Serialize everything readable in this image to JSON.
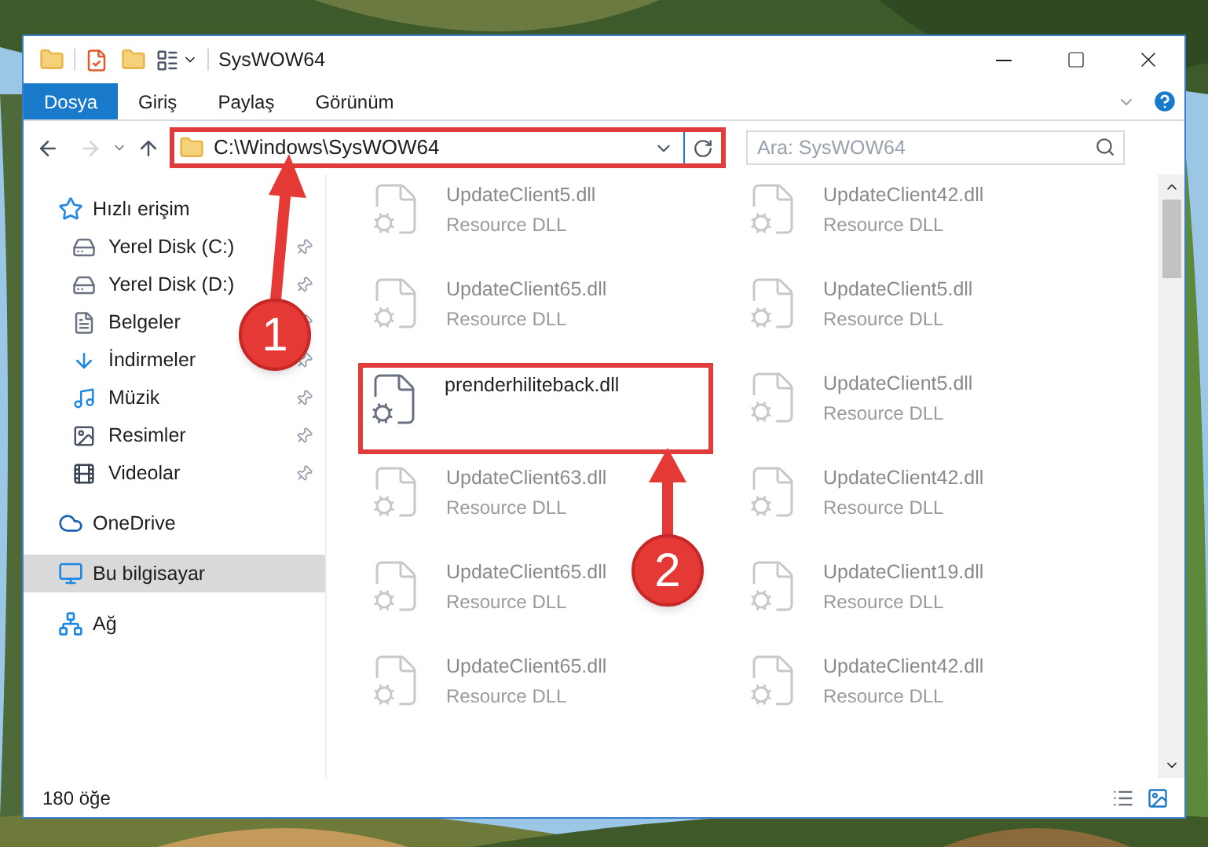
{
  "window": {
    "title": "SysWOW64"
  },
  "ribbon_tabs": [
    {
      "label": "Dosya",
      "selected": true
    },
    {
      "label": "Giriş",
      "selected": false
    },
    {
      "label": "Paylaş",
      "selected": false
    },
    {
      "label": "Görünüm",
      "selected": false
    }
  ],
  "address": {
    "path": "C:\\Windows\\SysWOW64",
    "annotated": true
  },
  "search": {
    "placeholder": "Ara: SysWOW64"
  },
  "nav_pane": [
    {
      "label": "Hızlı erişim",
      "selected": false,
      "children": [
        {
          "label": "Yerel Disk (C:)",
          "pinned": true
        },
        {
          "label": "Yerel Disk (D:)",
          "pinned": true
        },
        {
          "label": "Belgeler",
          "pinned": true
        },
        {
          "label": "İndirmeler",
          "pinned": true
        },
        {
          "label": "Müzik",
          "pinned": true
        },
        {
          "label": "Resimler",
          "pinned": true
        },
        {
          "label": "Videolar",
          "pinned": true
        }
      ]
    },
    {
      "label": "OneDrive",
      "selected": false
    },
    {
      "label": "Bu bilgisayar",
      "selected": true
    },
    {
      "label": "Ağ",
      "selected": false
    }
  ],
  "files": [
    {
      "name": "UpdateClient5.dll",
      "type": "Resource DLL",
      "faded": true,
      "annotated": false
    },
    {
      "name": "UpdateClient42.dll",
      "type": "Resource DLL",
      "faded": true,
      "annotated": false
    },
    {
      "name": "UpdateClient65.dll",
      "type": "Resource DLL",
      "faded": true,
      "annotated": false
    },
    {
      "name": "UpdateClient5.dll",
      "type": "Resource DLL",
      "faded": true,
      "annotated": false
    },
    {
      "name": "prenderhiliteback.dll",
      "faded": false,
      "annotated": true
    },
    {
      "name": "UpdateClient5.dll",
      "type": "Resource DLL",
      "faded": true,
      "annotated": false
    },
    {
      "name": "UpdateClient63.dll",
      "type": "Resource DLL",
      "faded": true,
      "annotated": false
    },
    {
      "name": "UpdateClient42.dll",
      "type": "Resource DLL",
      "faded": true,
      "annotated": false
    },
    {
      "name": "UpdateClient65.dll",
      "type": "Resource DLL",
      "faded": true,
      "annotated": false
    },
    {
      "name": "UpdateClient19.dll",
      "type": "Resource DLL",
      "faded": true,
      "annotated": false
    },
    {
      "name": "UpdateClient65.dll",
      "type": "Resource DLL",
      "faded": true,
      "annotated": false
    },
    {
      "name": "UpdateClient42.dll",
      "type": "Resource DLL",
      "faded": true,
      "annotated": false
    }
  ],
  "status_bar": {
    "item_count": "180 öğe"
  },
  "annotations": [
    {
      "number": "1"
    },
    {
      "number": "2"
    }
  ]
}
